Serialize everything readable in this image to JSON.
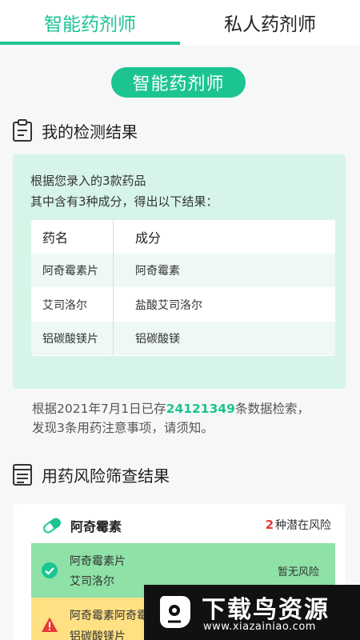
{
  "tabs": [
    {
      "label": "智能药剂师",
      "active": true
    },
    {
      "label": "私人药剂师",
      "active": false
    }
  ],
  "title_pill": "智能药剂师",
  "detection": {
    "heading": "我的检测结果",
    "line1": "根据您录入的3款药品",
    "line2": "其中含有3种成分，得出以下结果：",
    "table": {
      "headers": [
        "药名",
        "成分"
      ],
      "rows": [
        [
          "阿奇霉素片",
          "阿奇霉素"
        ],
        [
          "艾司洛尔",
          "盐酸艾司洛尔"
        ],
        [
          "铝碳酸镁片",
          "铝碳酸镁"
        ]
      ]
    }
  },
  "summary": {
    "prefix": "根据2021年7月1日已存",
    "count": "24121349",
    "suffix": "条数据检索，",
    "line2": "发现3条用药注意事项，请须知。"
  },
  "risk": {
    "heading": "用药风险筛查结果",
    "drug": "阿奇霉素",
    "count_num": "2",
    "count_text": "种潜在风险",
    "rows": [
      {
        "line1": "阿奇霉素片",
        "line2": "艾司洛尔",
        "status": "暂无风险"
      },
      {
        "line1": "阿奇霉素阿奇霉",
        "line2": "铝碳酸镁片",
        "status": ""
      }
    ]
  },
  "watermark": {
    "title": "下载鸟资源",
    "url": "www.xiazainiao.com"
  },
  "colors": {
    "accent": "#1cc492",
    "result_bg": "#d6f5e8",
    "safe": "#8ee1a7",
    "warn": "#ffe082",
    "danger": "#e53935"
  }
}
